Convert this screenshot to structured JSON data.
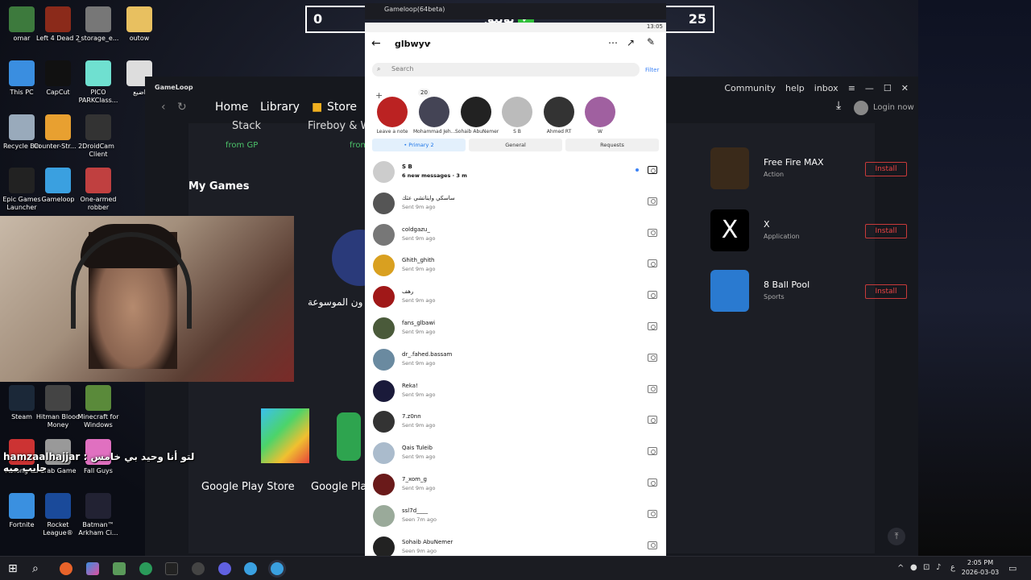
{
  "desktop": {
    "icons": [
      {
        "label": "omar",
        "icon": "user-folder-icon",
        "color": "#3d7a3d"
      },
      {
        "label": "Left 4 Dead 2",
        "icon": "left4dead-icon",
        "color": "#8b2a1a"
      },
      {
        "label": "_storage_e...",
        "icon": "image-file-icon",
        "color": "#777"
      },
      {
        "label": "outow",
        "icon": "folder-icon",
        "color": "#e8c060"
      },
      {
        "label": "This PC",
        "icon": "computer-icon",
        "color": "#3a8ee0"
      },
      {
        "label": "CapCut",
        "icon": "capcut-icon",
        "color": "#111"
      },
      {
        "label": "PICO PARKClass...",
        "icon": "pico-park-icon",
        "color": "#6fe0d0"
      },
      {
        "label": "اضيع",
        "icon": "file-icon",
        "color": "#ddd"
      },
      {
        "label": "Recycle Bin",
        "icon": "recycle-bin-icon",
        "color": "#9ab"
      },
      {
        "label": "Counter-Str... 2",
        "icon": "counter-strike-icon",
        "color": "#e8a030"
      },
      {
        "label": "DroidCam Client",
        "icon": "droidcam-icon",
        "color": "#333"
      },
      {
        "label": "Epic Games Launcher",
        "icon": "epic-games-icon",
        "color": "#222"
      },
      {
        "label": "Gameloop",
        "icon": "gameloop-icon",
        "color": "#3aa0e0"
      },
      {
        "label": "One-armed robber",
        "icon": "one-armed-robber-icon",
        "color": "#c04040"
      },
      {
        "label": "Steam",
        "icon": "steam-icon",
        "color": "#1b2838"
      },
      {
        "label": "Hitman Blood Money",
        "icon": "hitman-icon",
        "color": "#444"
      },
      {
        "label": "Minecraft for Windows",
        "icon": "minecraft-icon",
        "color": "#5a8a3a"
      },
      {
        "label": "Among Us",
        "icon": "among-us-icon",
        "color": "#c33"
      },
      {
        "label": "Crab Game",
        "icon": "crab-game-icon",
        "color": "#999"
      },
      {
        "label": "Fall Guys",
        "icon": "fall-guys-icon",
        "color": "#e070c0"
      },
      {
        "label": "Fortnite",
        "icon": "fortnite-icon",
        "color": "#3a90e0"
      },
      {
        "label": "Rocket League®",
        "icon": "rocket-league-icon",
        "color": "#1a4a9a"
      },
      {
        "label": "Batman™ Arkham Ci...",
        "icon": "batman-icon",
        "color": "#223"
      }
    ]
  },
  "gameloop": {
    "logo": "GameLoop",
    "nav": [
      "Home",
      "Library",
      "Store"
    ],
    "nav_extra": "Fireboy & W",
    "right_links": [
      "Community",
      "help",
      "inbox"
    ],
    "login": "Login now",
    "stack_label": "Stack",
    "from_gp": "from GP",
    "from_gp2": "from",
    "my_games": "My Games",
    "arabic_game": "من سيربح المليون الموسوعة",
    "arabic_game_short": "ون الموسوعة",
    "apps": [
      {
        "name": "Free Fire MAX",
        "category": "Action",
        "install": "Install",
        "color": "#3a2a1a"
      },
      {
        "name": "X",
        "category": "Application",
        "install": "Install",
        "color": "#000"
      },
      {
        "name": "8 Ball Pool",
        "category": "Sports",
        "install": "Install",
        "color": "#2a7ad0"
      }
    ],
    "store_items": [
      "Google Play Store",
      "Google Pla"
    ]
  },
  "score": {
    "left": "0",
    "right": "25",
    "label": "توثيق"
  },
  "phone_window": {
    "title": "Gameloop(64beta)"
  },
  "phone": {
    "time": "13:05",
    "username": "glbwyv",
    "search_placeholder": "Search",
    "filter": "Filter",
    "note_count": "20",
    "stories": [
      {
        "label": "Leave a note",
        "color": "#b22"
      },
      {
        "label": "Mohammad Jeh...",
        "color": "#445"
      },
      {
        "label": "Sohaib AbuNemer",
        "color": "#222"
      },
      {
        "label": "S B",
        "color": "#bbb"
      },
      {
        "label": "Ahmed RT",
        "color": "#333"
      },
      {
        "label": "W",
        "color": "#a060a0"
      }
    ],
    "tabs": [
      "• Primary 2",
      "General",
      "Requests"
    ],
    "messages": [
      {
        "name": "S B",
        "sub": "6 new messages · 3 m",
        "color": "#ccc"
      },
      {
        "name": "ساسكي وايتاتشي عثك",
        "sub": "Sent 9m ago",
        "color": "#555"
      },
      {
        "name": "coldgazu_",
        "sub": "Sent 9m ago",
        "color": "#777"
      },
      {
        "name": "Ghith_ghith",
        "sub": "Sent 9m ago",
        "color": "#d9a020"
      },
      {
        "name": "رهف",
        "sub": "Sent 9m ago",
        "color": "#a01818"
      },
      {
        "name": "fans_glbawi",
        "sub": "Sent 9m ago",
        "color": "#4a5a3a"
      },
      {
        "name": "dr_.fahed.bassam",
        "sub": "Sent 9m ago",
        "color": "#6a8aa0"
      },
      {
        "name": "Reka!",
        "sub": "Sent 9m ago",
        "color": "#1a1a3a"
      },
      {
        "name": "7.z0nn",
        "sub": "Sent 9m ago",
        "color": "#333"
      },
      {
        "name": "Qais Tuleib",
        "sub": "Sent 9m ago",
        "color": "#aabbcc"
      },
      {
        "name": "7_xom_g",
        "sub": "Sent 9m ago",
        "color": "#6a1a1a"
      },
      {
        "name": "ssl7d____",
        "sub": "Seen 7m ago",
        "color": "#9aaa9a"
      },
      {
        "name": "Sohaib AbuNemer",
        "sub": "Seen 9m ago",
        "color": "#222"
      }
    ]
  },
  "overlay": {
    "chat_line1": "hamzaalhajjar : لتو أنا وحيد بي خامس",
    "chat_line2": "جايب ميه"
  },
  "taskbar": {
    "time": "2:05 PM",
    "date": "2026-03-03",
    "lang": "ع"
  }
}
